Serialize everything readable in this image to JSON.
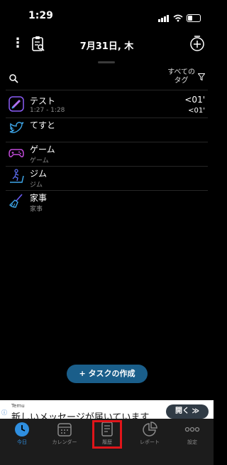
{
  "status": {
    "time": "1:29"
  },
  "header": {
    "date_title": "7月31日, 木"
  },
  "filter": {
    "tags_label_line1": "すべての",
    "tags_label_line2": "タグ"
  },
  "tasks": [
    {
      "name": "テスト",
      "subtitle": "1:27 - 1:28",
      "right_top": "<01'",
      "right_bottom": "<01'",
      "icon": "pen-icon",
      "icon_color": "#8a5cf6"
    },
    {
      "name": "てすと",
      "subtitle": "",
      "right_top": "",
      "right_bottom": "",
      "icon": "bird-icon",
      "icon_color": "#3ea6e8"
    },
    {
      "name": "ゲーム",
      "subtitle": "ゲーム",
      "right_top": "",
      "right_bottom": "",
      "icon": "gamepad-icon",
      "icon_color": "#c04ad8"
    },
    {
      "name": "ジム",
      "subtitle": "ジム",
      "right_top": "",
      "right_bottom": "",
      "icon": "treadmill-icon",
      "icon_color": "#5a6cf0"
    },
    {
      "name": "家事",
      "subtitle": "家事",
      "right_top": "",
      "right_bottom": "",
      "icon": "broom-icon",
      "icon_color": "#6a5cf6"
    }
  ],
  "create_button": {
    "label": "+ タスクの作成"
  },
  "ad": {
    "advertiser": "Temu",
    "headline": "新しいメッセージが届いています",
    "button_label": "開く ≫"
  },
  "tabs": [
    {
      "label": "今日",
      "icon": "clock-icon",
      "active": true
    },
    {
      "label": "カレンダー",
      "icon": "calendar-icon",
      "active": false
    },
    {
      "label": "履歴",
      "icon": "history-icon",
      "active": false
    },
    {
      "label": "レポート",
      "icon": "pie-chart-icon",
      "active": false
    },
    {
      "label": "設定",
      "icon": "more-dots-icon",
      "active": false
    }
  ],
  "colors": {
    "accent": "#2f8fe0",
    "create_button": "#1a5e8a",
    "highlight": "#e0151a"
  }
}
